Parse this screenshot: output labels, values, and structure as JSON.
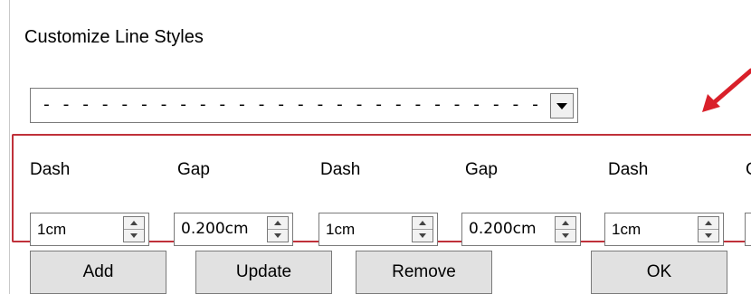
{
  "dialog": {
    "title": "Customize Line Styles",
    "style_combo_value": "- - - - - - - - - - - - - - - - - - - - - - - - - - - - - - - -"
  },
  "fields": [
    {
      "label": "Dash",
      "value": "1cm"
    },
    {
      "label": "Gap",
      "value": "0.200cm"
    },
    {
      "label": "Dash",
      "value": "1cm"
    },
    {
      "label": "Gap",
      "value": "0.200cm"
    },
    {
      "label": "Dash",
      "value": "1cm"
    },
    {
      "label": "G",
      "value": ""
    }
  ],
  "buttons": {
    "add": "Add",
    "update": "Update",
    "remove": "Remove",
    "ok": "OK"
  },
  "colors": {
    "highlight_box": "#c0313a",
    "annotation_arrow": "#d9202a"
  },
  "icons": {
    "combo_dropdown": "chevron-down-icon",
    "spinner": "spin-updown-icon",
    "annotation": "red-arrow-icon"
  }
}
